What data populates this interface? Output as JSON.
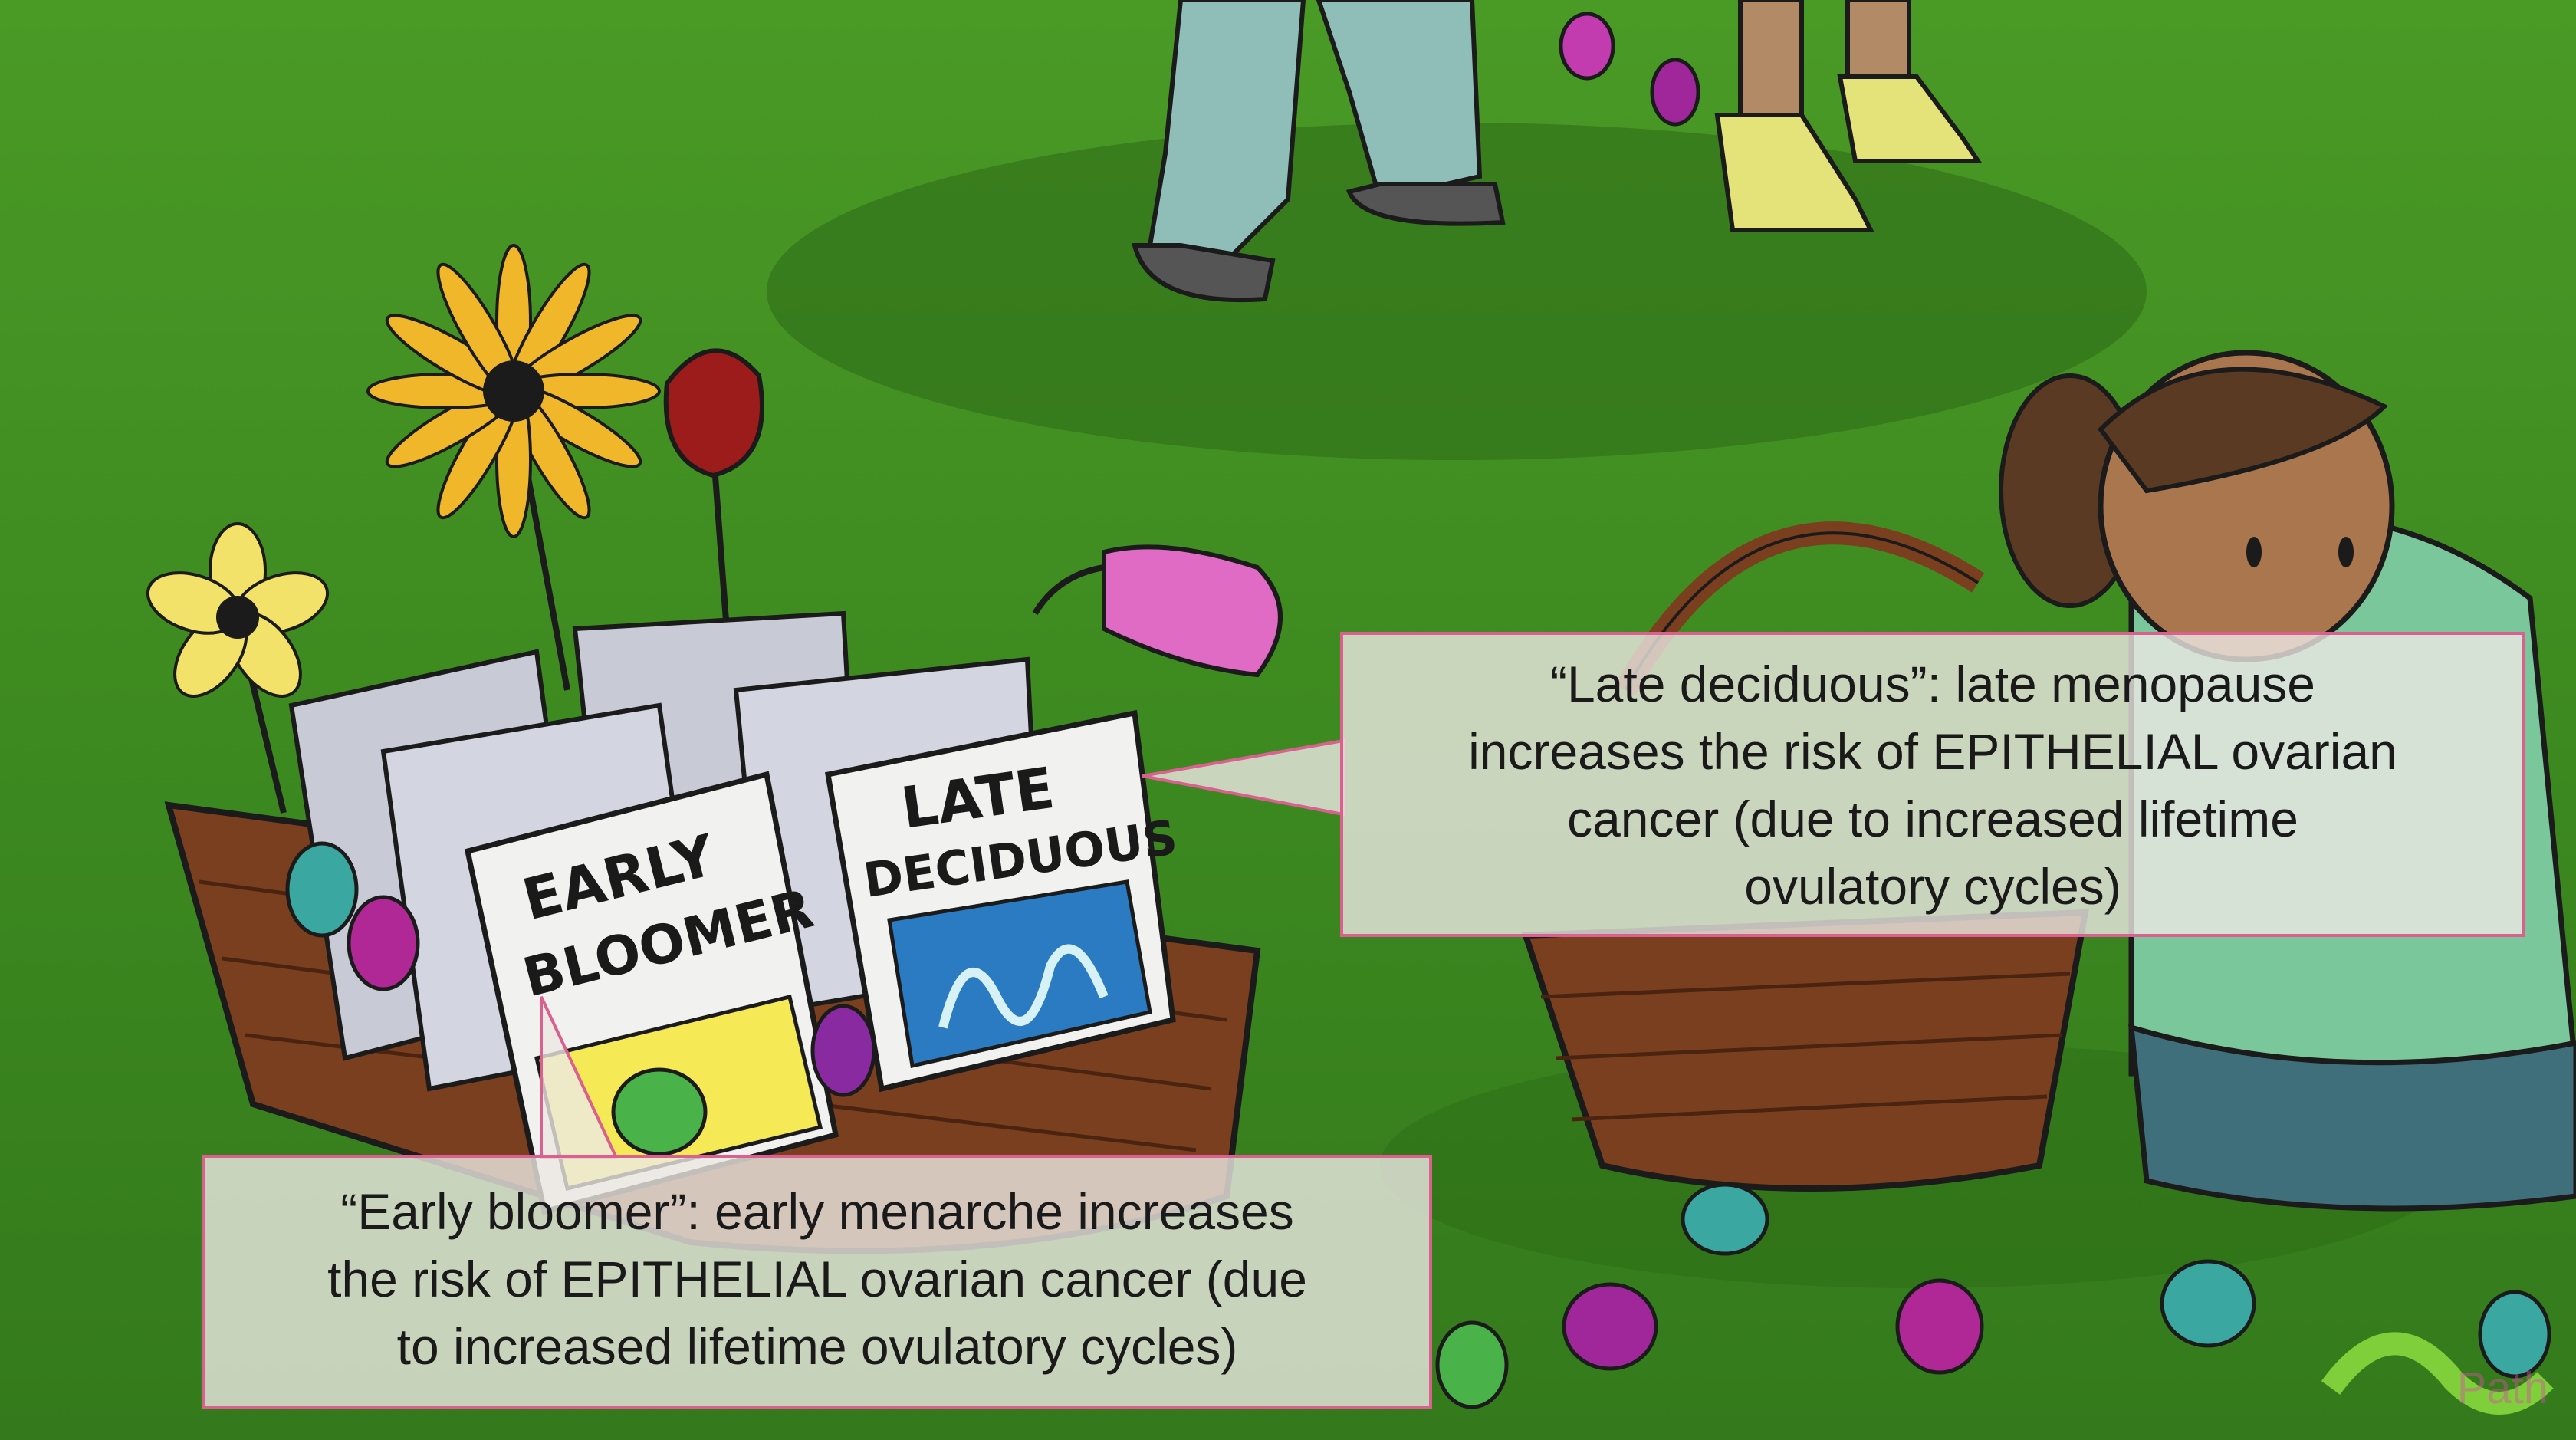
{
  "callouts": {
    "late": {
      "lines": [
        "“Late deciduous”: late menopause",
        "increases the risk of EPITHELIAL ovarian",
        "cancer (due to increased lifetime",
        "ovulatory cycles)"
      ]
    },
    "early": {
      "lines": [
        "“Early bloomer”: early menarche increases",
        "the risk of EPITHELIAL ovarian cancer (due",
        "to increased lifetime ovulatory cycles)"
      ]
    }
  },
  "packets": {
    "early_line1": "EARLY",
    "early_line2": "BLOOMER",
    "late_line1": "LATE",
    "late_line2": "DECIDUOUS"
  },
  "watermark": "Path",
  "colors": {
    "grass": "#3f8a22",
    "callout_border": "#d9608f",
    "basket": "#7a3f1e",
    "egg_purple": "#a0279a",
    "egg_teal": "#3aa8a0"
  }
}
